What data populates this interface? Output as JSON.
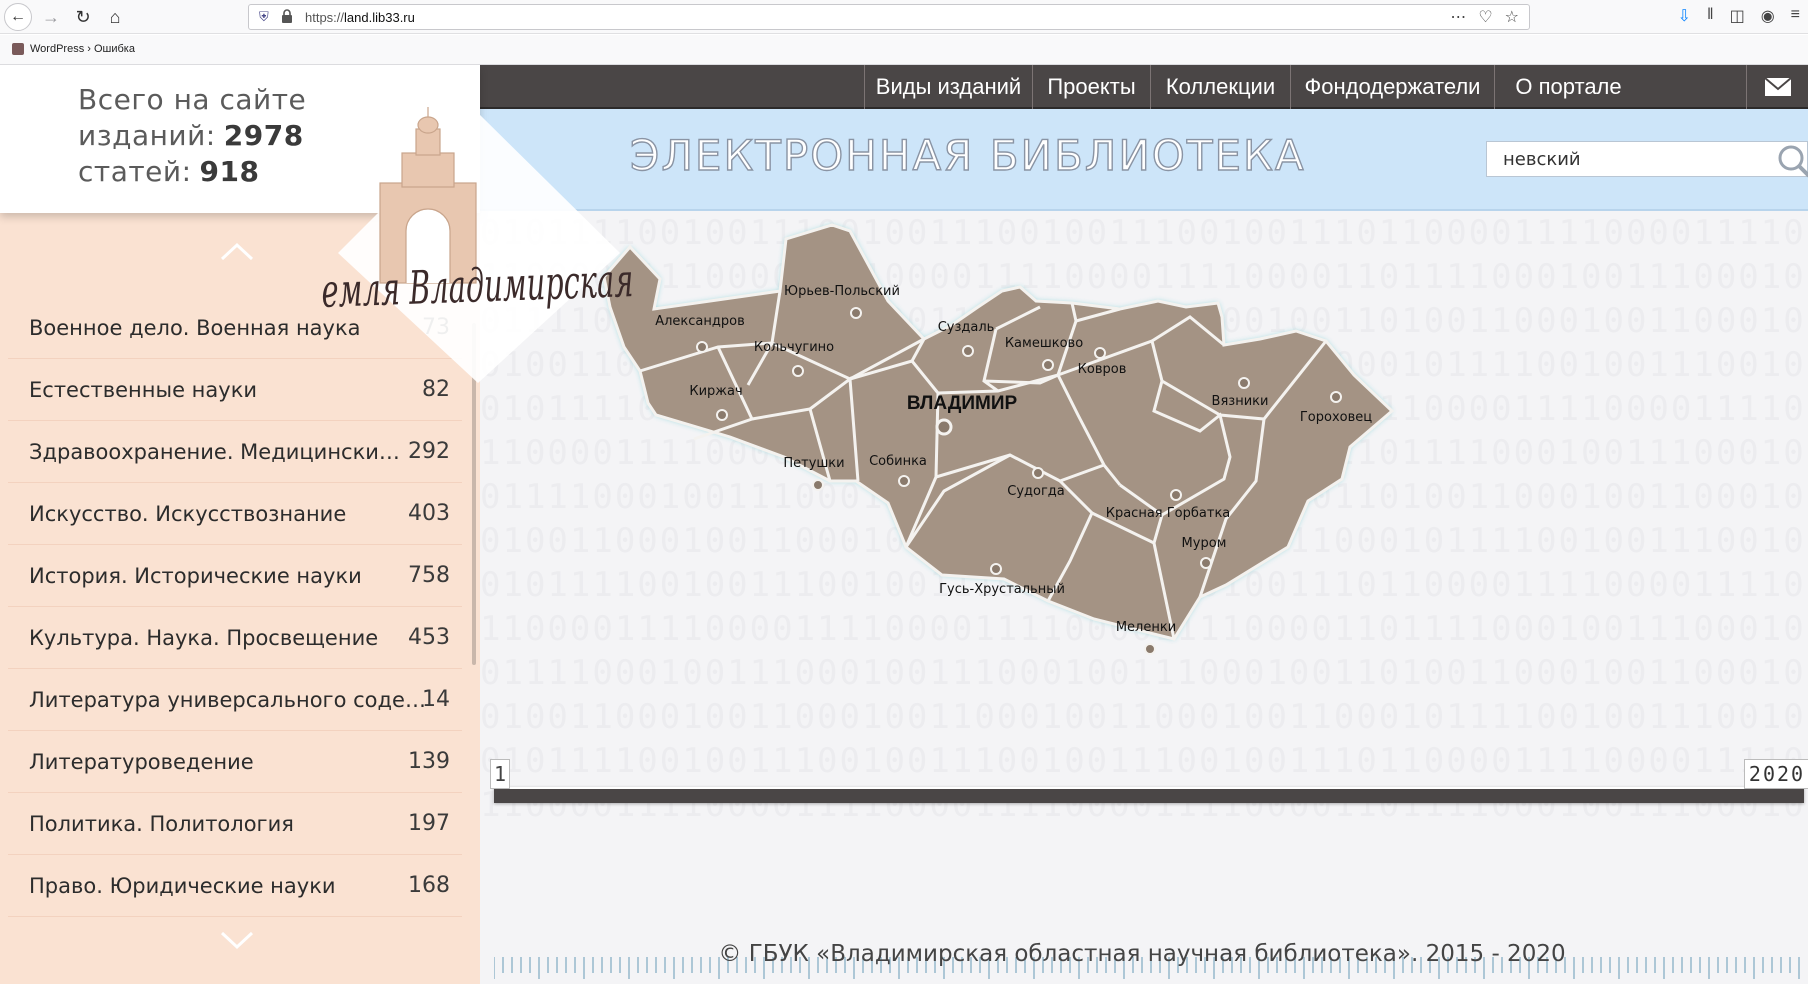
{
  "browser": {
    "url_prefix": "https://",
    "url_domain": "land.lib33.ru",
    "bookmark": "WordPress › Ошибка"
  },
  "stats": {
    "line1": "Всего на сайте",
    "editions_label": "изданий:",
    "editions_count": "2978",
    "articles_label": "статей:",
    "articles_count": "918"
  },
  "logo": {
    "text": "Земля Владимирская"
  },
  "categories": [
    {
      "name": "Военное дело. Военная наука",
      "count": "73"
    },
    {
      "name": "Естественные науки",
      "count": "82"
    },
    {
      "name": "Здравоохранение. Медицински…",
      "count": "292"
    },
    {
      "name": "Искусство. Искусствознание",
      "count": "403"
    },
    {
      "name": "История. Исторические науки",
      "count": "758"
    },
    {
      "name": "Культура. Наука. Просвещение",
      "count": "453"
    },
    {
      "name": "Литература универсального соде…",
      "count": "14"
    },
    {
      "name": "Литературоведение",
      "count": "139"
    },
    {
      "name": "Политика. Политология",
      "count": "197"
    },
    {
      "name": "Право. Юридические науки",
      "count": "168"
    }
  ],
  "nav": {
    "items": [
      "Виды изданий",
      "Проекты",
      "Коллекции",
      "Фондодержатели",
      "О портале"
    ]
  },
  "banner": {
    "title": "ЭЛЕКТРОННАЯ БИБЛИОТЕКА"
  },
  "search": {
    "value": "невский"
  },
  "map": {
    "capital": "ВЛАДИМИР",
    "districts": [
      "Александров",
      "Юрьев-Польский",
      "Кольчугино",
      "Суздаль",
      "Камешково",
      "Ковров",
      "Вязники",
      "Гороховец",
      "Киржач",
      "Петушки",
      "Собинка",
      "Судогда",
      "Красная Горбатка",
      "Муром",
      "Гусь-Хрустальный",
      "Меленки"
    ]
  },
  "timeline": {
    "start_year": "1",
    "end_year": "2020"
  },
  "footer": {
    "text": "© ГБУК «Владимирская областная научная библиотека». 2015 - 2020"
  },
  "colors": {
    "left_panel": "#fae2d2",
    "nav_bg": "#4a4646",
    "banner_bg": "#cde5f9",
    "map_region": "#a49384",
    "map_outline": "#7fd0d6"
  }
}
